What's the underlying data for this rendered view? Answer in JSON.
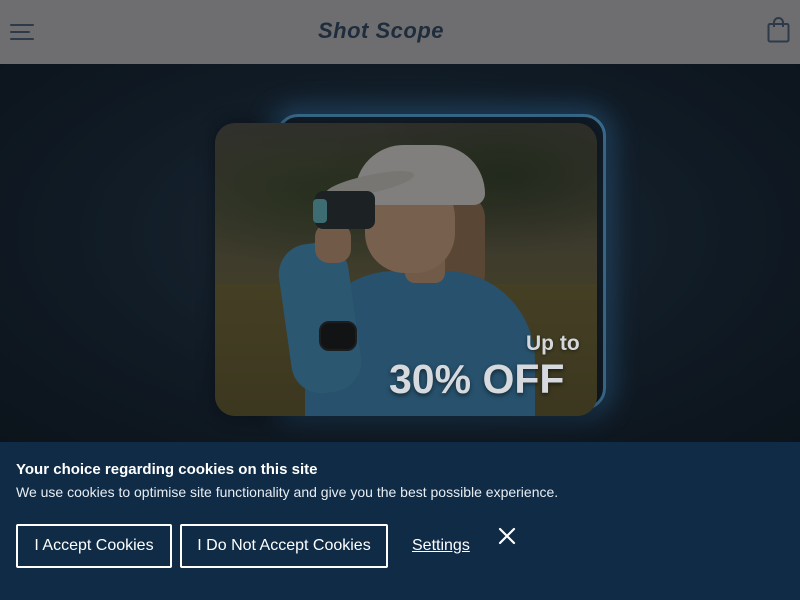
{
  "header": {
    "logo_text": "Shot Scope",
    "menu_icon": "hamburger-menu-icon",
    "cart_icon": "shopping-bag-icon"
  },
  "hero": {
    "promo_prefix": "Up to",
    "promo_headline": "30% OFF",
    "accent_color": "#5aa8dc"
  },
  "cookie_banner": {
    "title": "Your choice regarding cookies on this site",
    "description": "We use cookies to optimise site functionality and give you the best possible experience.",
    "accept_label": "I Accept Cookies",
    "decline_label": "I Do Not Accept Cookies",
    "settings_label": "Settings",
    "close_icon": "close-icon",
    "background_color": "#0f2b46"
  }
}
